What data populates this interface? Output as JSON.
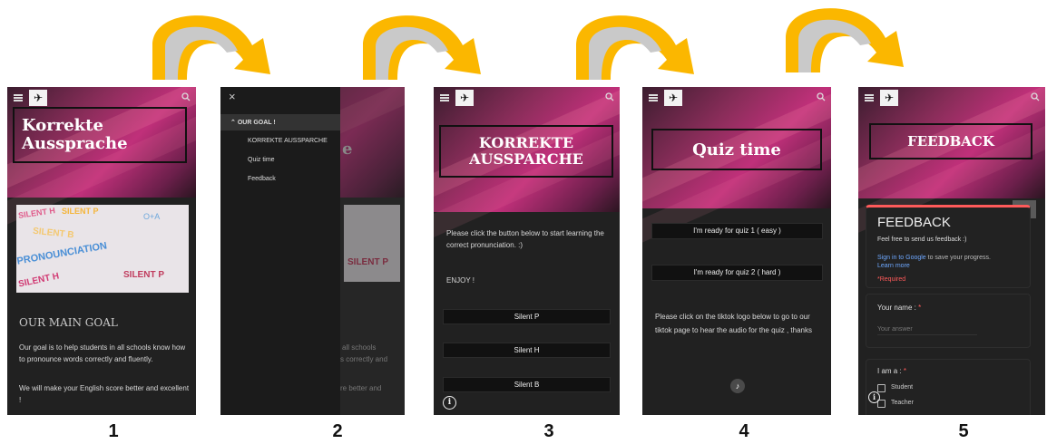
{
  "colors": {
    "arrow": "#fbb700",
    "arrow_inner": "#c9c9c9",
    "dark_bg": "#212121",
    "accent_red": "#ff5a5a"
  },
  "step_numbers": [
    "1",
    "2",
    "3",
    "4",
    "5"
  ],
  "panel1": {
    "title_line1": "Korrekte",
    "title_line2": "Aussprache",
    "image_words": [
      "SILENT H",
      "SILENT P",
      "O+A",
      "SILENT B",
      "PRONOUNCIATION",
      "SILENT P",
      "SILENT H"
    ],
    "heading": "OUR MAIN GOAL",
    "para1": "Our goal is to help students in all schools know how to pronounce words correctly and fluently.",
    "para2": "We will make your English score better and excellent !"
  },
  "panel2": {
    "close": "×",
    "menu_header": "OUR GOAL !",
    "menu_items": [
      "KORREKTE AUSSPARCHE",
      "Quiz time",
      "Feedback"
    ],
    "bg_fragments": [
      "e",
      "all schools",
      "s correctly and",
      "re better and"
    ]
  },
  "panel3": {
    "title_line1": "KORREKTE",
    "title_line2": "AUSSPARCHE",
    "intro": "Please click the button below to start learning the correct pronunciation. :)",
    "enjoy": "ENJOY !",
    "buttons": [
      "Silent P",
      "Silent H",
      "Silent B"
    ]
  },
  "panel4": {
    "title": "Quiz time",
    "buttons": [
      "I'm ready for quiz 1 ( easy )",
      "I'm ready for quiz 2 ( hard )"
    ],
    "text": "Please click on the tiktok logo below to go to our tiktok page to hear the audio for the quiz , thanks"
  },
  "panel5": {
    "title": "FEEDBACK",
    "form_title": "FEEDBACK",
    "form_desc": "Feel free to send us feedback :)",
    "signin_link": "Sign in to Google",
    "signin_rest": " to save your progress.",
    "learn_more": "Learn more",
    "required": "*Required",
    "q1_label": "Your name :",
    "q1_star": "*",
    "q1_placeholder": "Your answer",
    "q2_label": "I am a :",
    "q2_star": "*",
    "q2_options": [
      "Student",
      "Teacher"
    ]
  },
  "icons": {
    "menu": "menu-icon",
    "search": "search-icon",
    "logo": "airplane-logo",
    "info": "info-icon",
    "tiktok": "tiktok-icon",
    "external": "open-external-icon",
    "close": "close-icon"
  }
}
